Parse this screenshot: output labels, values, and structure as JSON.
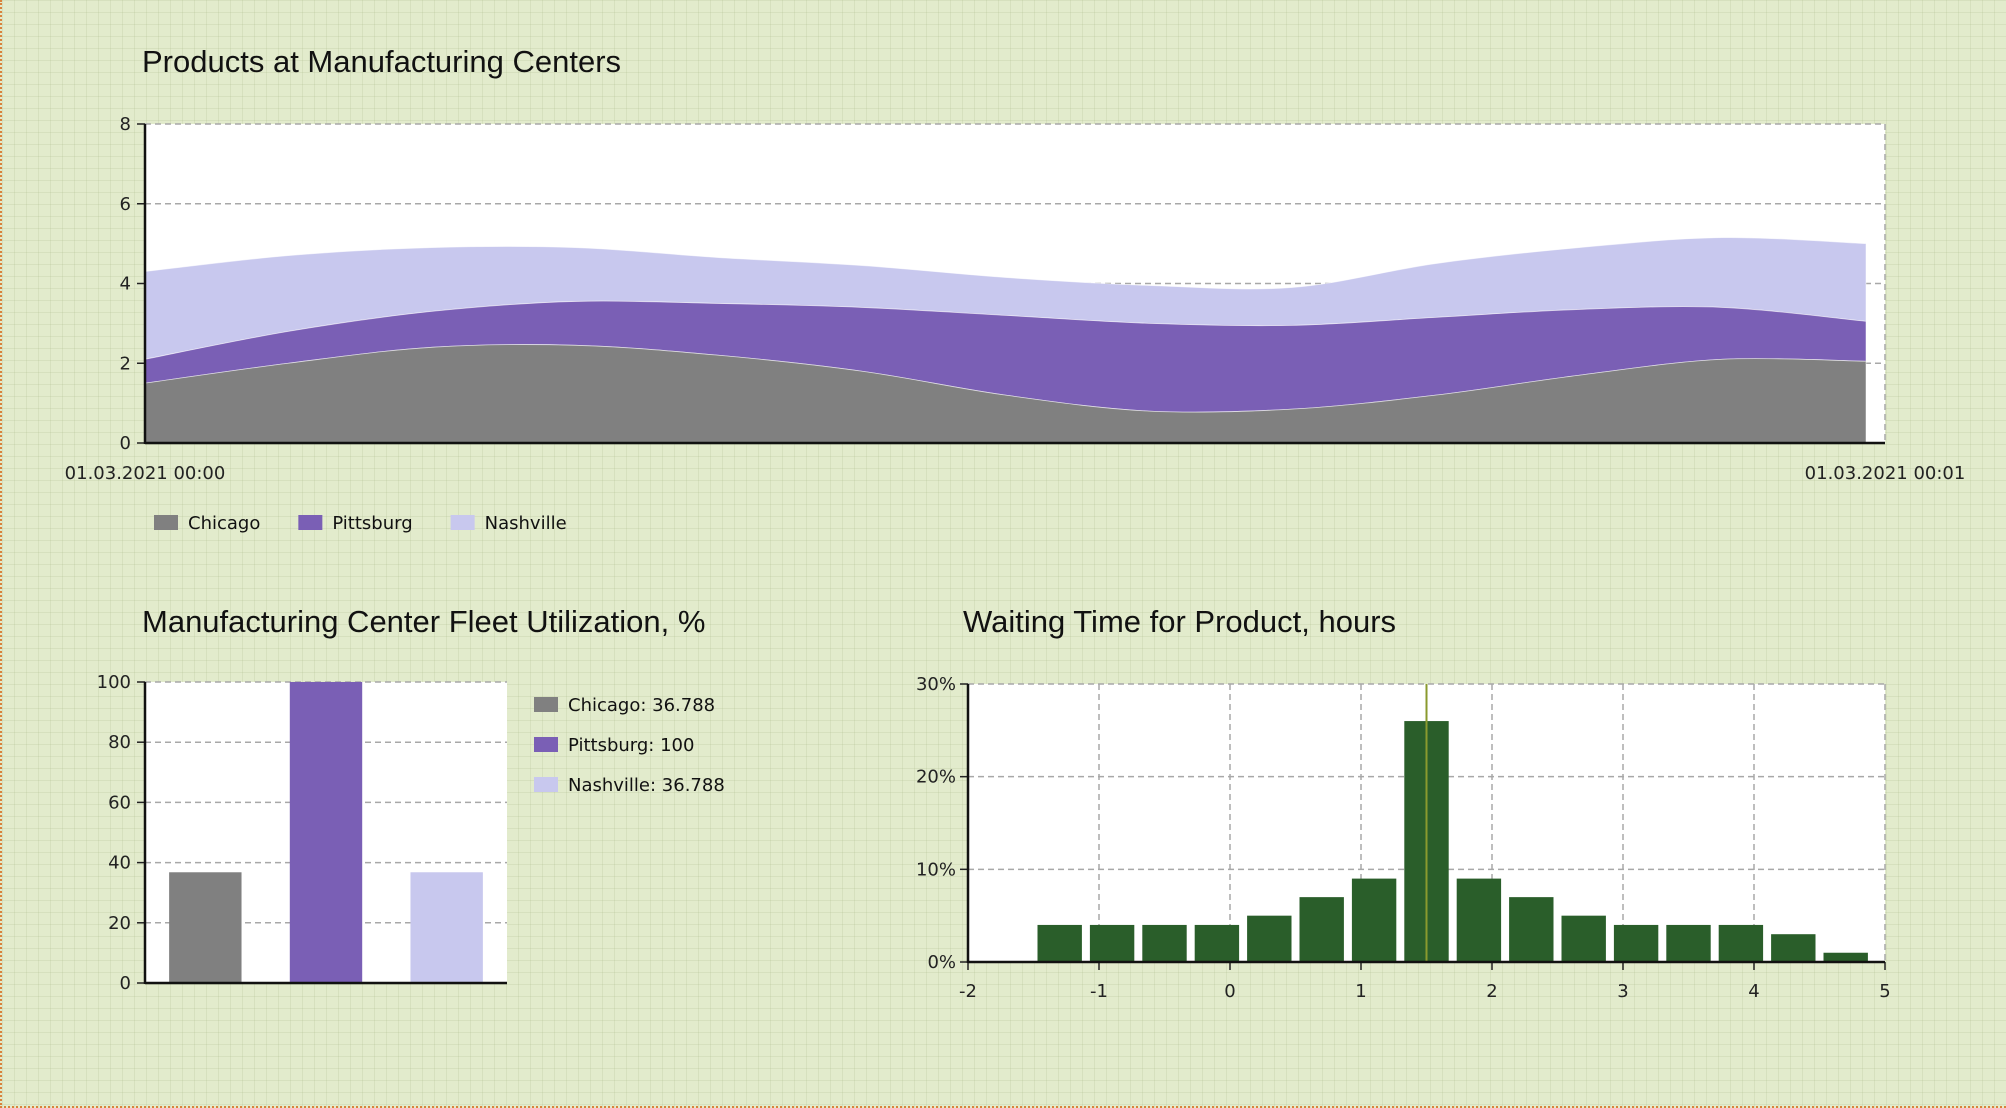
{
  "chart_data": [
    {
      "type": "area",
      "title": "Products at Manufacturing Centers",
      "stacked": true,
      "x_labels": [
        "01.03.2021 00:00",
        "01.03.2021 00:01"
      ],
      "ylim": [
        0,
        8
      ],
      "y_ticks": [
        0,
        2,
        4,
        6,
        8
      ],
      "grid": true,
      "legend": "bottom-left",
      "series": [
        {
          "name": "Chicago",
          "color": "#808080",
          "values": [
            1.5,
            2.0,
            2.4,
            2.45,
            2.2,
            1.8,
            1.2,
            0.8,
            0.85,
            1.2,
            1.7,
            2.1,
            2.05
          ]
        },
        {
          "name": "Pittsburg",
          "color": "#7a5fb5",
          "values": [
            0.6,
            0.8,
            0.9,
            1.1,
            1.3,
            1.6,
            2.0,
            2.2,
            2.1,
            1.95,
            1.65,
            1.3,
            1.0
          ]
        },
        {
          "name": "Nashville",
          "color": "#c8c8ee",
          "values": [
            2.2,
            1.9,
            1.6,
            1.35,
            1.15,
            1.05,
            0.95,
            0.95,
            0.95,
            1.35,
            1.55,
            1.75,
            1.95
          ]
        }
      ]
    },
    {
      "type": "bar",
      "title": "Manufacturing Center Fleet Utilization, %",
      "categories": [
        "Chicago",
        "Pittsburg",
        "Nashville"
      ],
      "values": [
        36.788,
        100,
        36.788
      ],
      "colors": [
        "#808080",
        "#7a5fb5",
        "#c8c8ee"
      ],
      "legend_labels": [
        "Chicago: 36.788",
        "Pittsburg: 100",
        "Nashville: 36.788"
      ],
      "ylim": [
        0,
        100
      ],
      "y_ticks": [
        0,
        20,
        40,
        60,
        80,
        100
      ],
      "grid": true,
      "legend": "right"
    },
    {
      "type": "bar",
      "subtype": "histogram",
      "title": "Waiting Time for Product, hours",
      "xlim": [
        -2,
        5
      ],
      "x_ticks": [
        -2,
        -1,
        0,
        1,
        2,
        3,
        4,
        5
      ],
      "ylim": [
        0,
        30
      ],
      "y_ticks": [
        0,
        10,
        20,
        30
      ],
      "y_tick_labels": [
        "0%",
        "10%",
        "20%",
        "30%"
      ],
      "bin_width": 0.4,
      "bins_start": [
        -1.5,
        -1.1,
        -0.7,
        -0.3,
        0.1,
        0.5,
        0.9,
        1.3,
        1.7,
        2.1,
        2.5,
        2.9,
        3.3,
        3.7,
        4.1,
        4.5
      ],
      "values": [
        4,
        4,
        4,
        4,
        5,
        7,
        9,
        26,
        9,
        7,
        5,
        4,
        4,
        4,
        3,
        1
      ],
      "bar_color": "#2a5e2a",
      "mean_marker": 1.5,
      "marker_color": "#8a9a2e",
      "grid": true
    }
  ]
}
